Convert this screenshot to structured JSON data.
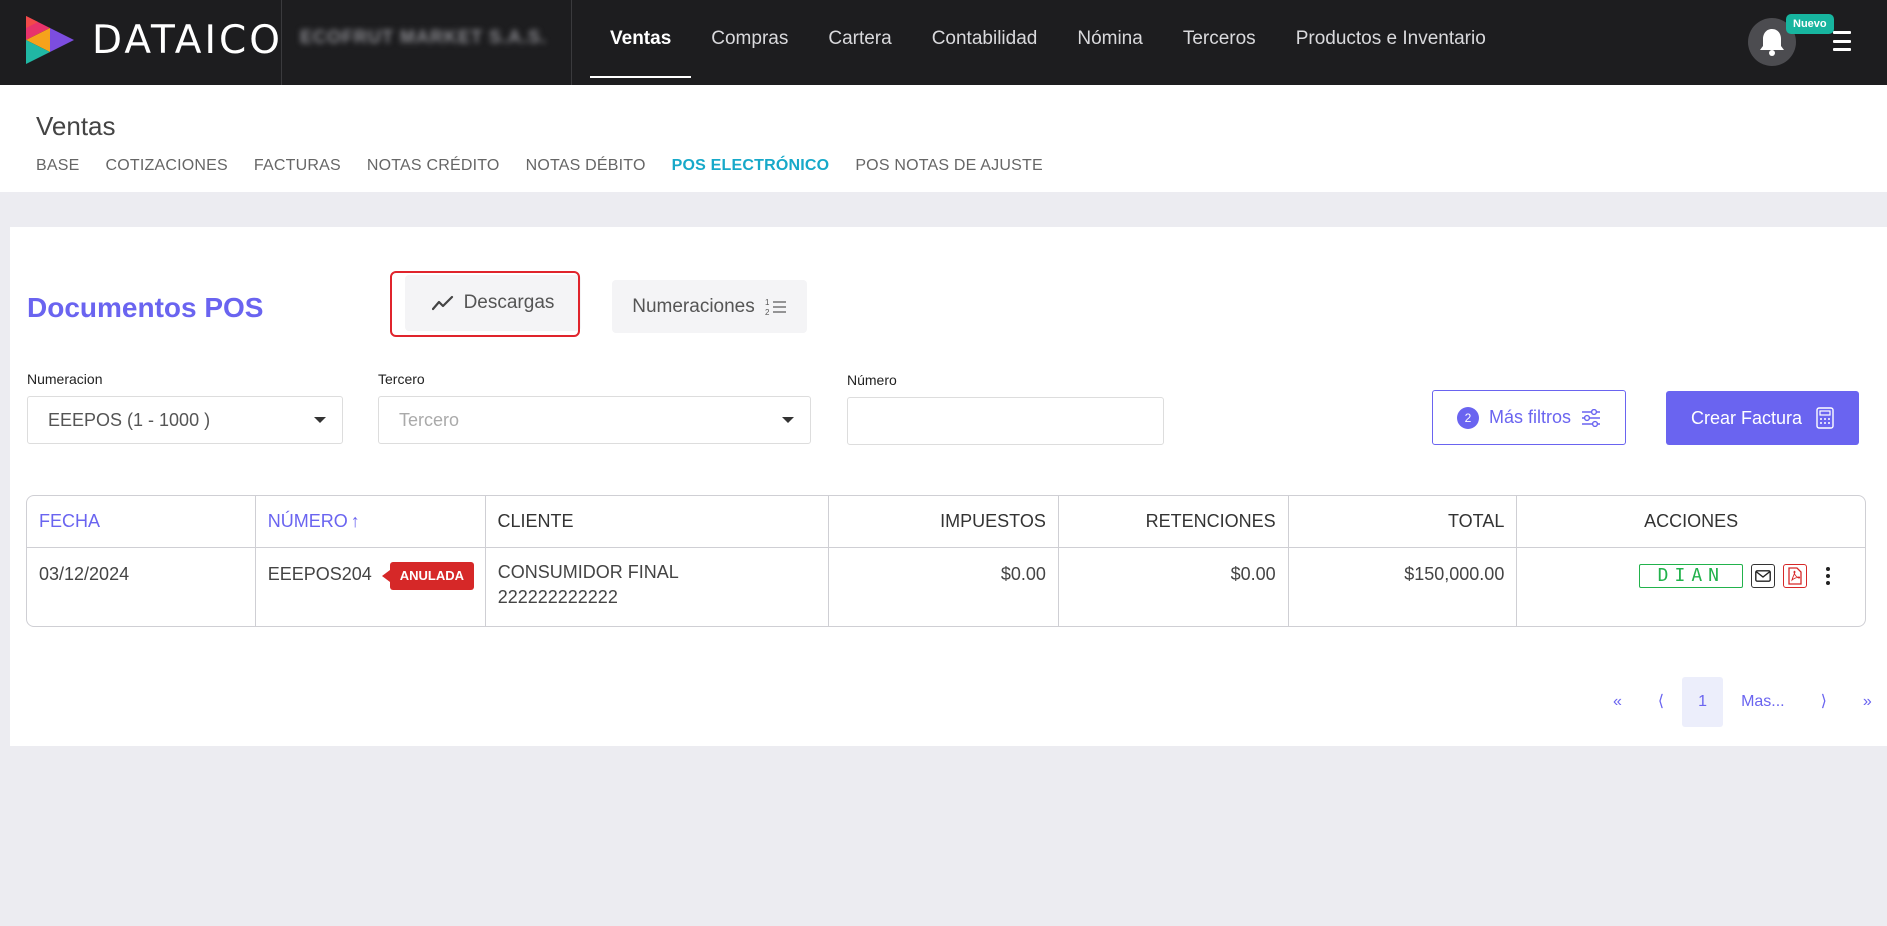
{
  "app": {
    "brand": "DATAICO",
    "company": "ECOFRUT MARKET S.A.S."
  },
  "nav": {
    "items": [
      "Ventas",
      "Compras",
      "Cartera",
      "Contabilidad",
      "Nómina",
      "Terceros",
      "Productos e Inventario"
    ],
    "active": "Ventas"
  },
  "notifications": {
    "badge": "Nuevo"
  },
  "section": {
    "title": "Ventas"
  },
  "subtabs": [
    "BASE",
    "COTIZACIONES",
    "FACTURAS",
    "NOTAS CRÉDITO",
    "NOTAS DÉBITO",
    "POS ELECTRÓNICO",
    "POS NOTAS DE AJUSTE"
  ],
  "active_subtab": "POS ELECTRÓNICO",
  "page": {
    "title": "Documentos POS",
    "descargas_label": "Descargas",
    "numeraciones_label": "Numeraciones"
  },
  "filters": {
    "numeracion_label": "Numeracion",
    "numeracion_value": "EEEPOS (1 - 1000 )",
    "tercero_label": "Tercero",
    "tercero_placeholder": "Tercero",
    "numero_label": "Número",
    "numero_value": "",
    "mas_filtros_count": "2",
    "mas_filtros_label": "Más filtros",
    "crear_label": "Crear Factura"
  },
  "table": {
    "headers": [
      "FECHA",
      "NÚMERO",
      "CLIENTE",
      "IMPUESTOS",
      "RETENCIONES",
      "TOTAL",
      "ACCIONES"
    ],
    "rows": [
      {
        "fecha": "03/12/2024",
        "numero": "EEEPOS204",
        "status": "ANULADA",
        "cliente_nombre": "CONSUMIDOR FINAL",
        "cliente_id": "222222222222",
        "impuestos": "$0.00",
        "retenciones": "$0.00",
        "total": "$150,000.00",
        "dian_label": "DIAN"
      }
    ]
  },
  "pagination": {
    "first": "«",
    "prev": "⟨",
    "current": "1",
    "more": "Mas...",
    "next": "⟩",
    "last": "»"
  },
  "colors": {
    "accent": "#6a64f0",
    "teal": "#17a9c9",
    "danger": "#d62828",
    "success": "#22b24c",
    "topbar": "#1d1d1f"
  }
}
